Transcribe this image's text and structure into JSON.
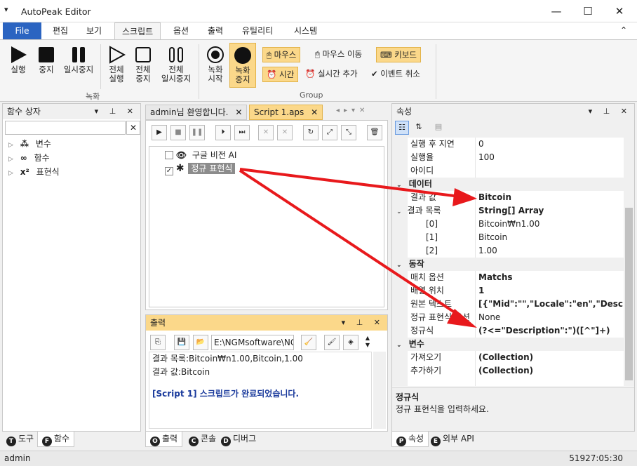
{
  "window": {
    "title": "AutoPeak Editor",
    "minimize": "—",
    "maximize": "☐",
    "close": "✕",
    "sys_menu": "▾"
  },
  "menu": {
    "file": "File",
    "tabs": [
      "편집",
      "보기",
      "스크립트",
      "옵션",
      "출력",
      "유틸리티",
      "시스템"
    ],
    "collapse": "⌃"
  },
  "ribbon": {
    "run": "실행",
    "stop": "중지",
    "pause": "일시중지",
    "run_all": [
      "전체",
      "실행"
    ],
    "stop_all": [
      "전체",
      "중지"
    ],
    "pause_all": [
      "전체",
      "일시중지"
    ],
    "rec_start": [
      "녹화",
      "시작"
    ],
    "rec_stop": [
      "녹화",
      "중지"
    ],
    "mouse": "마우스",
    "mouse_move": "마우스 이동",
    "keyboard": "키보드",
    "time": "시간",
    "add_realtime": "실시간 추가",
    "cancel_event": "이벤트 취소",
    "group_record": "녹화",
    "group_group": "Group"
  },
  "function_box": {
    "title": "함수 상자",
    "items": [
      "변수",
      "함수",
      "표현식"
    ]
  },
  "tabs": {
    "welcome": "admin님 환영합니다.",
    "script": "Script 1.aps"
  },
  "script_items": [
    {
      "label": "구글 비전 AI",
      "checked": false
    },
    {
      "label": "정규 표현식",
      "checked": true
    }
  ],
  "output": {
    "title": "출력",
    "path": "E:\\NGMsoftware\\NG",
    "lines": [
      "결과 목록:Bitcoin₩n1.00,Bitcoin,1.00",
      "결과 값:Bitcoin"
    ],
    "done": "[Script 1] 스크립트가 완료되었습니다."
  },
  "properties": {
    "title": "속성",
    "rows": [
      {
        "k": "실행 후 지연",
        "v": "0"
      },
      {
        "k": "실행율",
        "v": "100"
      },
      {
        "k": "아이디",
        "v": ""
      }
    ],
    "data_section": "데이터",
    "result_value": {
      "k": "결과 값",
      "v": "Bitcoin"
    },
    "result_list": {
      "k": "결과 목록",
      "v": "String[] Array"
    },
    "list_items": [
      {
        "k": "[0]",
        "v": "Bitcoin₩n1.00"
      },
      {
        "k": "[1]",
        "v": "Bitcoin"
      },
      {
        "k": "[2]",
        "v": "1.00"
      }
    ],
    "action_section": "동작",
    "action_rows": [
      {
        "k": "매치 옵션",
        "v": "Matchs"
      },
      {
        "k": "배열 위치",
        "v": "1"
      },
      {
        "k": "원본 텍스트",
        "v": "[{\"Mid\":\"\",\"Locale\":\"en\",\"Descriptio"
      },
      {
        "k": "정규 표현식 옵션",
        "v": "None"
      },
      {
        "k": "정규식",
        "v": "(?<=\"Description\":\")([^\"]+)"
      }
    ],
    "var_section": "변수",
    "var_rows": [
      {
        "k": "가져오기",
        "v": "(Collection)"
      },
      {
        "k": "추가하기",
        "v": "(Collection)"
      }
    ],
    "desc_title": "정규식",
    "desc_text": "정규 표현식을 입력하세요."
  },
  "bottom_tabs": {
    "left": [
      {
        "icon": "T",
        "label": "도구"
      },
      {
        "icon": "F",
        "label": "함수"
      }
    ],
    "mid": [
      {
        "icon": "O",
        "label": "출력"
      },
      {
        "icon": "C",
        "label": "콘솔"
      },
      {
        "icon": "D",
        "label": "디버그"
      }
    ],
    "right": [
      {
        "icon": "P",
        "label": "속성"
      },
      {
        "icon": "E",
        "label": "외부 API"
      }
    ]
  },
  "status": {
    "user": "admin",
    "time": "51927:05:30"
  },
  "colors": {
    "accent": "#2b64c1",
    "highlight": "#fbd88a",
    "arrow": "#e8191c",
    "link_text": "#1a3a9c"
  }
}
